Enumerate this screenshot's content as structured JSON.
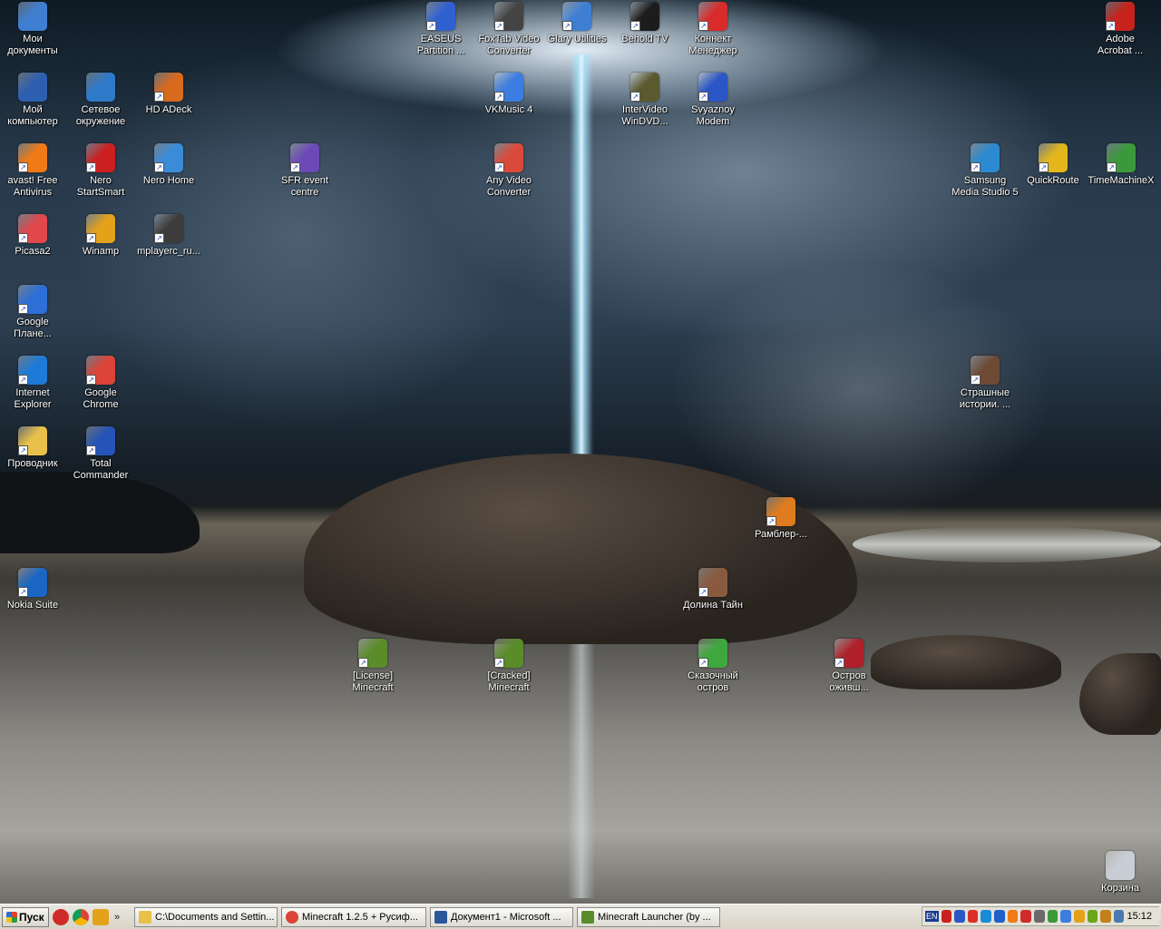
{
  "desktop_icons": [
    {
      "label": "Мои\nдокументы",
      "icon": "folder-documents-icon",
      "color": "#3f7fd1"
    },
    {
      "label": "Мой\nкомпьютер",
      "icon": "computer-icon",
      "color": "#2d5fb1"
    },
    {
      "label": "Сетевое\nокружение",
      "icon": "network-icon",
      "color": "#2f79c9"
    },
    {
      "label": "HD ADeck",
      "icon": "audio-deck-icon",
      "color": "#d86a1e"
    },
    {
      "label": "avast! Free\nAntivirus",
      "icon": "antivirus-icon",
      "color": "#f07a17"
    },
    {
      "label": "Nero\nStartSmart",
      "icon": "nero-icon",
      "color": "#cc1f1f"
    },
    {
      "label": "Nero Home",
      "icon": "home-icon",
      "color": "#3a8cd8"
    },
    {
      "label": "SFR event\ncentre",
      "icon": "gear-icon",
      "color": "#6d49b8"
    },
    {
      "label": "Picasa2",
      "icon": "photo-icon",
      "color": "#e0484b"
    },
    {
      "label": "Winamp",
      "icon": "winamp-icon",
      "color": "#e4a21b"
    },
    {
      "label": "mplayerc_ru...",
      "icon": "video-player-icon",
      "color": "#3b3b3b"
    },
    {
      "label": "Google\nПлане...",
      "icon": "globe-icon",
      "color": "#2d6fd6"
    },
    {
      "label": "Internet\nExplorer",
      "icon": "browser-ie-icon",
      "color": "#1d7ad8"
    },
    {
      "label": "Google\nChrome",
      "icon": "browser-chrome-icon",
      "color": "#db4437"
    },
    {
      "label": "Проводник",
      "icon": "explorer-folder-icon",
      "color": "#e9c14a"
    },
    {
      "label": "Total\nCommander",
      "icon": "floppy-icon",
      "color": "#2454b8"
    },
    {
      "label": "Nokia Suite",
      "icon": "nokia-icon",
      "color": "#1a66c2"
    },
    {
      "label": "EASEUS\nPartition ...",
      "icon": "partition-icon",
      "color": "#3060d0"
    },
    {
      "label": "FoxTab Video\nConverter",
      "icon": "speaker-icon",
      "color": "#444444"
    },
    {
      "label": "Glary Utilities",
      "icon": "toolbox-icon",
      "color": "#3f7fd1"
    },
    {
      "label": "Behold TV",
      "icon": "tv-icon",
      "color": "#1c1c1c"
    },
    {
      "label": "Коннект\nМенеджер",
      "icon": "connect-icon",
      "color": "#d92b2b"
    },
    {
      "label": "VKMusic 4",
      "icon": "music-icon",
      "color": "#3b7de0"
    },
    {
      "label": "InterVideo\nWinDVD...",
      "icon": "dvd-icon",
      "color": "#5a5a2e"
    },
    {
      "label": "Svyaznoy\nModem",
      "icon": "modem-icon",
      "color": "#2a56c6"
    },
    {
      "label": "Any Video\nConverter",
      "icon": "video-converter-icon",
      "color": "#d94a3a"
    },
    {
      "label": "Adobe\nAcrobat ...",
      "icon": "pdf-icon",
      "color": "#c7221c"
    },
    {
      "label": "Samsung\nMedia Studio 5",
      "icon": "media-studio-icon",
      "color": "#2b8ad1"
    },
    {
      "label": "QuickRoute",
      "icon": "route-icon",
      "color": "#e3b61c"
    },
    {
      "label": "TimeMachineX",
      "icon": "time-machine-icon",
      "color": "#3a9a3a"
    },
    {
      "label": "Страшные\nистории. ...",
      "icon": "game-face-icon",
      "color": "#6e4a34"
    },
    {
      "label": "Рамблер-...",
      "icon": "rambler-icon",
      "color": "#e07b1f"
    },
    {
      "label": "Долина Тайн",
      "icon": "game-face-icon",
      "color": "#8a5a3e"
    },
    {
      "label": "[License]\nMinecraft",
      "icon": "minecraft-block-icon",
      "color": "#5b8c2a"
    },
    {
      "label": "[Cracked]\nMinecraft",
      "icon": "minecraft-block-icon",
      "color": "#5b8c2a"
    },
    {
      "label": "Сказочный\nостров",
      "icon": "island-game-icon",
      "color": "#3ea83e"
    },
    {
      "label": "Остров\nоживш...",
      "icon": "rose-icon",
      "color": "#b0202a"
    },
    {
      "label": "Корзина",
      "icon": "recycle-bin-icon",
      "color": "#c9ced6"
    }
  ],
  "taskbar": {
    "start_label": "Пуск",
    "quick_launch": [
      {
        "icon": "opera-icon",
        "color": "#d02b2b"
      },
      {
        "icon": "chrome-icon",
        "color": "#db4437"
      },
      {
        "icon": "winamp-icon",
        "color": "#e4a21b"
      }
    ],
    "chevron": "»",
    "tasks": [
      {
        "label": "C:\\Documents and Settin...",
        "icon": "folder-icon",
        "color": "#e9c14a"
      },
      {
        "label": "Minecraft 1.2.5 + Русиф...",
        "icon": "chrome-icon",
        "color": "#db4437"
      },
      {
        "label": "Документ1 - Microsoft ...",
        "icon": "word-icon",
        "color": "#2b579a"
      },
      {
        "label": "Minecraft Launcher (by ...",
        "icon": "minecraft-block-icon",
        "color": "#5b8c2a"
      }
    ],
    "tray": {
      "language": "EN",
      "icons": [
        {
          "icon": "antivirus-tray-icon",
          "color": "#c8201f"
        },
        {
          "icon": "network-tray-icon",
          "color": "#2a56c6"
        },
        {
          "icon": "nero-tray-icon",
          "color": "#d9312a"
        },
        {
          "icon": "skype-tray-icon",
          "color": "#1a8ad6"
        },
        {
          "icon": "media-tray-icon",
          "color": "#2060c8"
        },
        {
          "icon": "avast-tray-icon",
          "color": "#f07a17"
        },
        {
          "icon": "record-tray-icon",
          "color": "#d02b2b"
        },
        {
          "icon": "volume-tray-icon",
          "color": "#6a6a6a"
        },
        {
          "icon": "safely-remove-tray-icon",
          "color": "#3a9a3a"
        },
        {
          "icon": "display-tray-icon",
          "color": "#3b7de0"
        },
        {
          "icon": "winamp-tray-icon",
          "color": "#e4a21b"
        },
        {
          "icon": "nvidia-tray-icon",
          "color": "#6aa51a"
        },
        {
          "icon": "tool-tray-icon",
          "color": "#c2801a"
        },
        {
          "icon": "checklist-tray-icon",
          "color": "#4a7ab0"
        }
      ],
      "clock": "15:12"
    }
  }
}
